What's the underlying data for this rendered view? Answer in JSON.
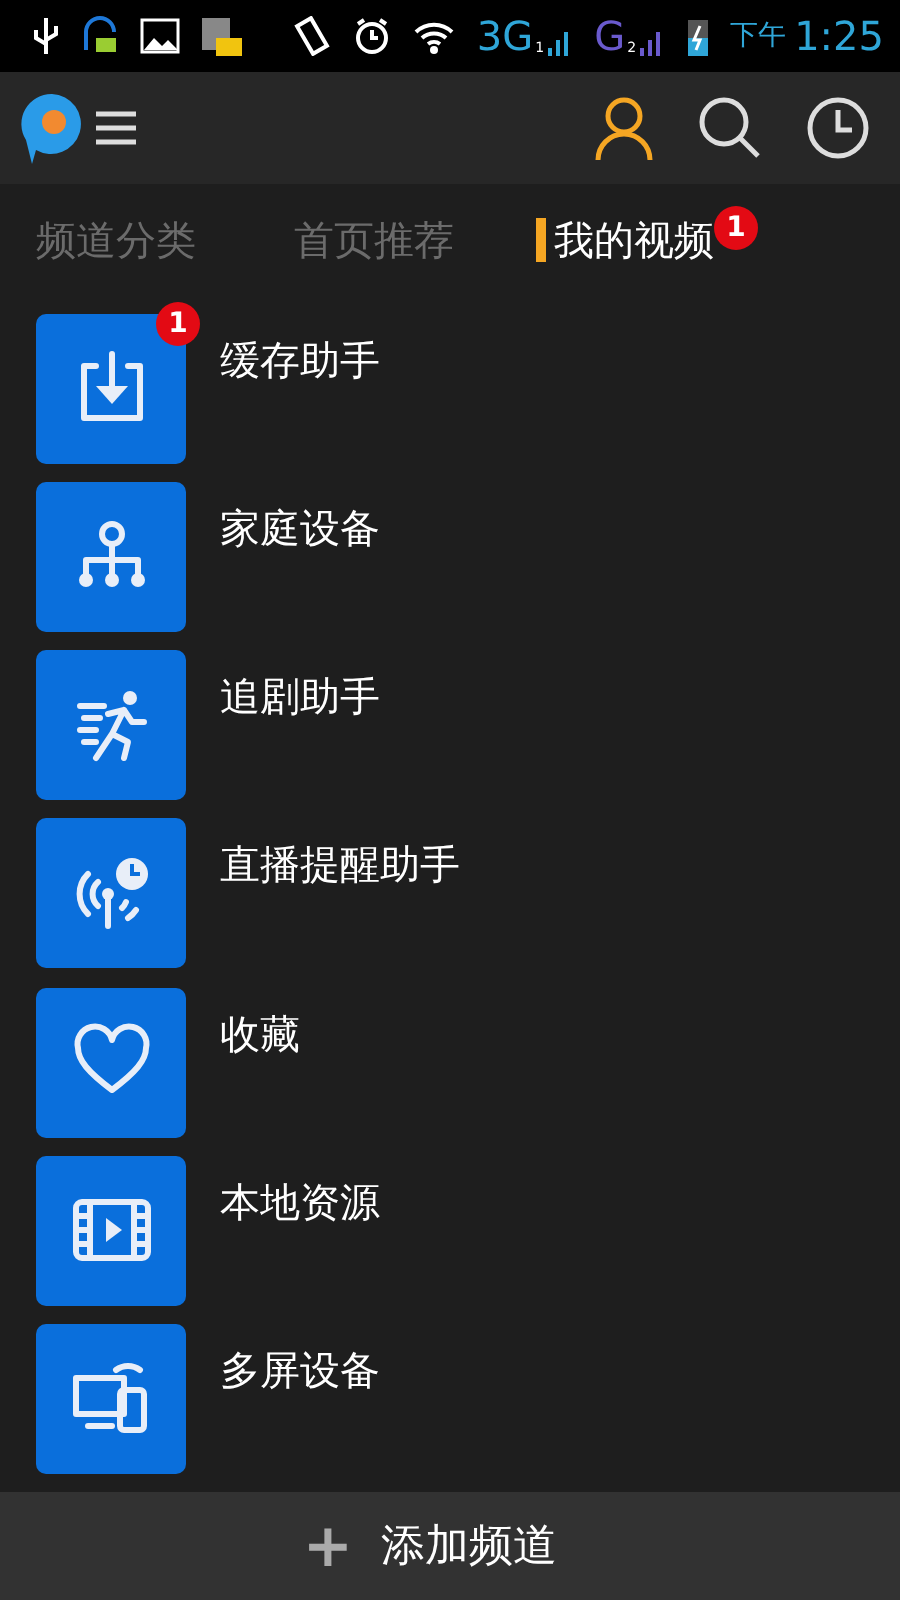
{
  "status_bar": {
    "network_1": "3G",
    "sim_1": "1",
    "network_2": "G",
    "sim_2": "2",
    "period": "下午",
    "time": "1:25"
  },
  "tabs": [
    {
      "label": "频道分类",
      "selected": false
    },
    {
      "label": "首页推荐",
      "selected": false
    },
    {
      "label": "我的视频",
      "selected": true,
      "badge": "1"
    }
  ],
  "items": [
    {
      "label": "缓存助手",
      "kind": "download",
      "badge": "1"
    },
    {
      "label": "家庭设备",
      "kind": "network"
    },
    {
      "label": "追剧助手",
      "kind": "runner"
    },
    {
      "label": "直播提醒助手",
      "kind": "broadcast"
    },
    {
      "label": "收藏",
      "kind": "heart"
    },
    {
      "label": "本地资源",
      "kind": "film"
    },
    {
      "label": "多屏设备",
      "kind": "screens"
    }
  ],
  "bottom_bar": {
    "icon": "+",
    "label": "添加频道"
  }
}
